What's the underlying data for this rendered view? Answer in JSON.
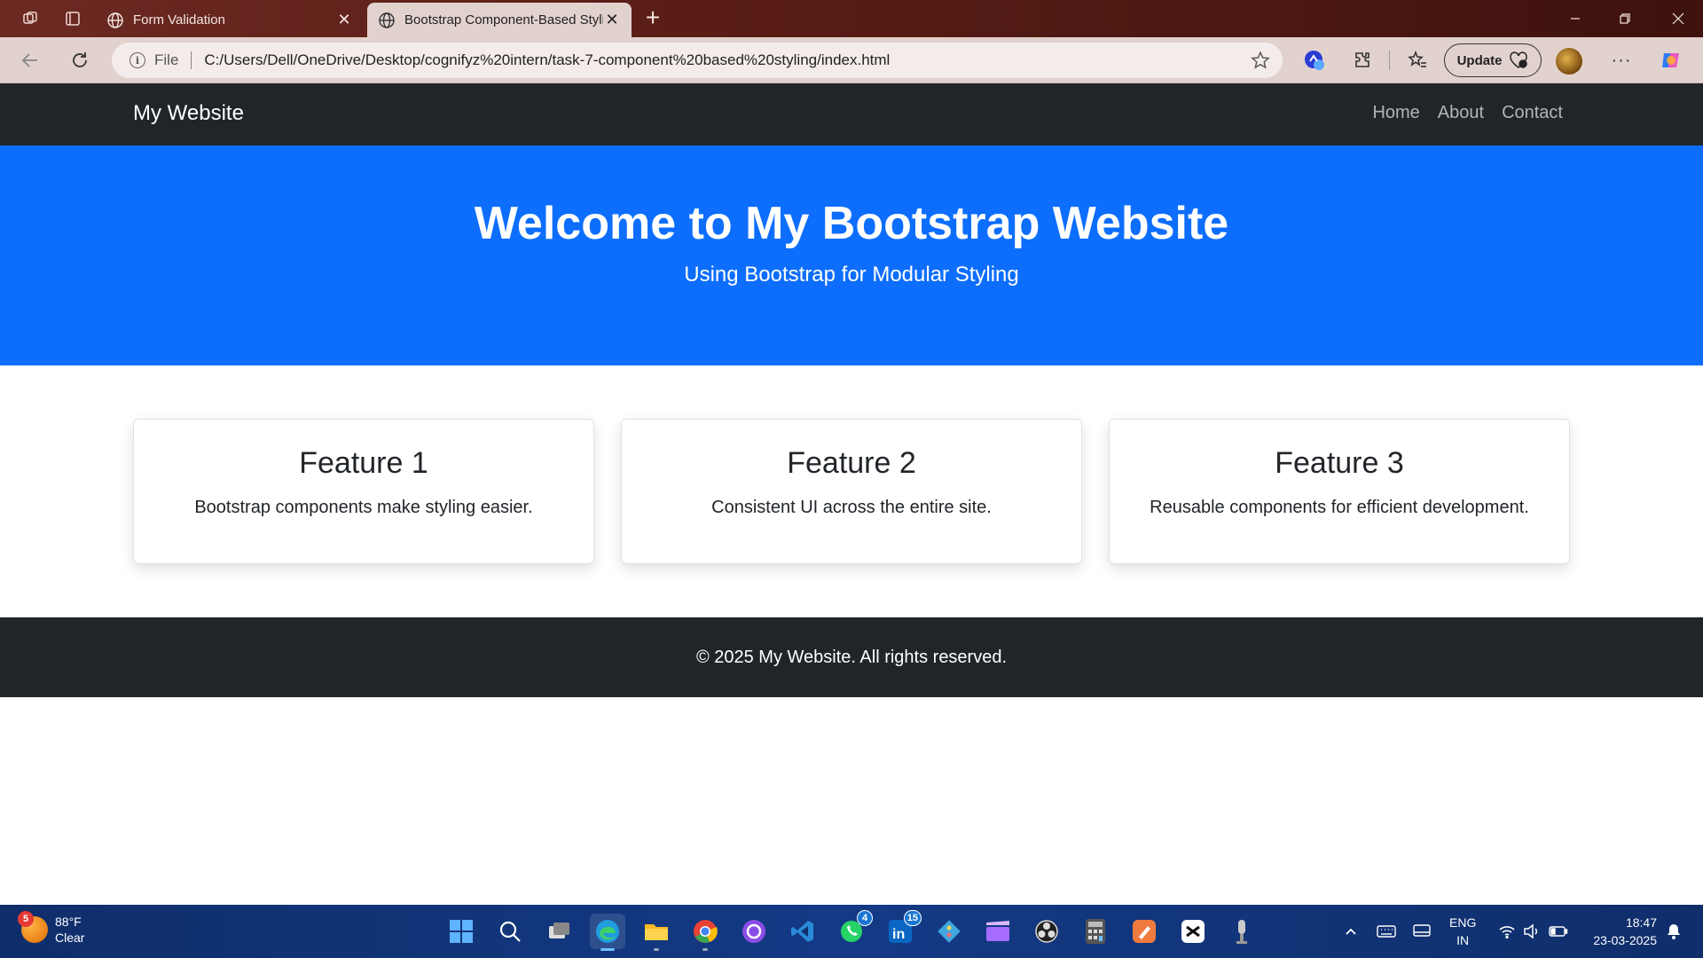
{
  "browser": {
    "tabs": [
      {
        "title": "Form Validation",
        "active": false
      },
      {
        "title": "Bootstrap Component-Based Styling",
        "active": true
      }
    ],
    "address": {
      "scheme_label": "File",
      "url": "C:/Users/Dell/OneDrive/Desktop/cognifyz%20intern/task-7-component%20based%20styling/index.html"
    },
    "update_label": "Update"
  },
  "site": {
    "brand": "My Website",
    "nav": [
      "Home",
      "About",
      "Contact"
    ],
    "hero": {
      "title": "Welcome to My Bootstrap Website",
      "subtitle": "Using Bootstrap for Modular Styling"
    },
    "features": [
      {
        "title": "Feature 1",
        "text": "Bootstrap components make styling easier."
      },
      {
        "title": "Feature 2",
        "text": "Consistent UI across the entire site."
      },
      {
        "title": "Feature 3",
        "text": "Reusable components for efficient development."
      }
    ],
    "footer": "© 2025 My Website. All rights reserved.",
    "colors": {
      "navbar": "#212529",
      "hero": "#0d6efd",
      "footer": "#212529"
    }
  },
  "taskbar": {
    "weather": {
      "badge": "5",
      "temp": "88°F",
      "condition": "Clear"
    },
    "badges": {
      "whatsapp": "4",
      "linkedin": "15"
    },
    "lang": {
      "line1": "ENG",
      "line2": "IN"
    },
    "clock": {
      "time": "18:47",
      "date": "23-03-2025"
    }
  }
}
